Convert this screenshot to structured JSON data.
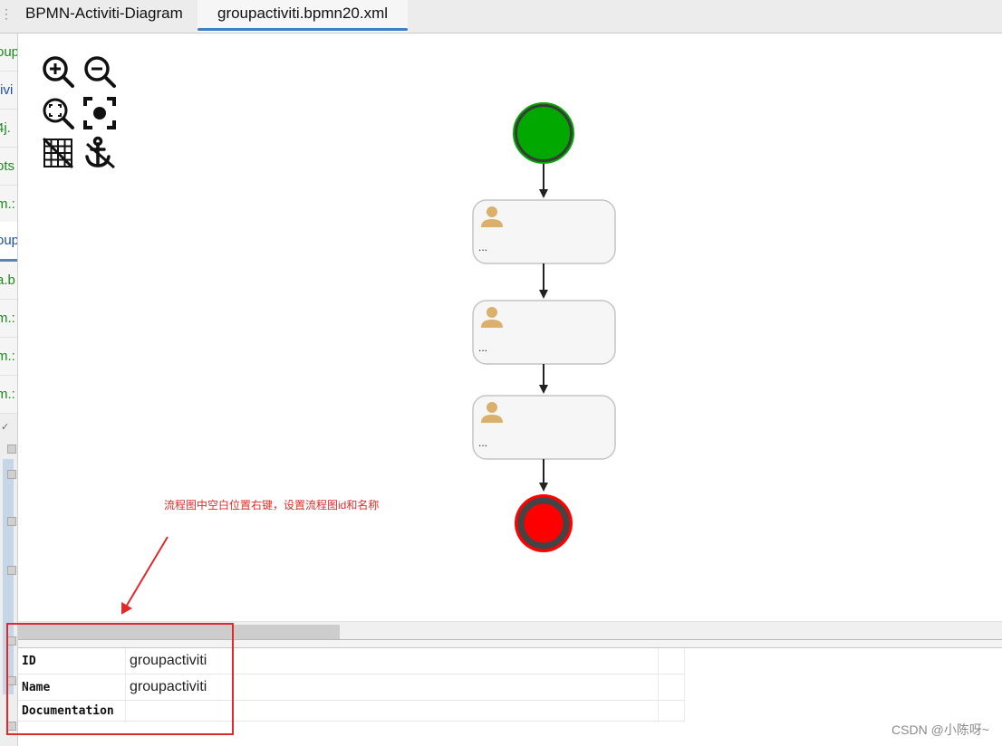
{
  "tabs": {
    "menu_glyph": "⋮",
    "items": [
      {
        "label": "BPMN-Activiti-Diagram",
        "active": false
      },
      {
        "label": "groupactiviti.bpmn20.xml",
        "active": true
      }
    ]
  },
  "left_tree": {
    "rows": [
      {
        "text": "oup",
        "color": "green"
      },
      {
        "text": "tivi",
        "color": "blue"
      },
      {
        "text": "4j.",
        "color": "green"
      },
      {
        "text": "ots",
        "color": "green"
      },
      {
        "text": "m.:",
        "color": "green"
      },
      {
        "text": "oup",
        "color": "blue",
        "selected": true
      },
      {
        "text": "a.b",
        "color": "green"
      },
      {
        "text": "m.:",
        "color": "green"
      },
      {
        "text": "m.:",
        "color": "green"
      },
      {
        "text": "m.:",
        "color": "green"
      }
    ],
    "expander_glyph": "✓"
  },
  "toolbar": {
    "buttons": [
      {
        "name": "zoom-in-icon",
        "title": "zoom in"
      },
      {
        "name": "zoom-out-icon",
        "title": "zoom out"
      },
      {
        "name": "zoom-fit-icon",
        "title": "zoom to fit"
      },
      {
        "name": "zoom-reset-icon",
        "title": "actual size"
      },
      {
        "name": "grid-toggle-icon",
        "title": "toggle grid"
      },
      {
        "name": "anchor-icon",
        "title": "snap to anchor"
      }
    ]
  },
  "diagram": {
    "start_event_color": "#00a800",
    "end_event_color": "#ff0000",
    "tasks": [
      {
        "type": "user-task",
        "label": "..."
      },
      {
        "type": "user-task",
        "label": "..."
      },
      {
        "type": "user-task",
        "label": "..."
      }
    ]
  },
  "annotation": {
    "text": "流程图中空白位置右键，设置流程图id和名称",
    "color": "#e22b2b"
  },
  "properties": {
    "rows": [
      {
        "key": "ID",
        "value": "groupactiviti"
      },
      {
        "key": "Name",
        "value": "groupactiviti"
      },
      {
        "key": "Documentation",
        "value": ""
      }
    ]
  },
  "watermark": "CSDN @小陈呀~"
}
